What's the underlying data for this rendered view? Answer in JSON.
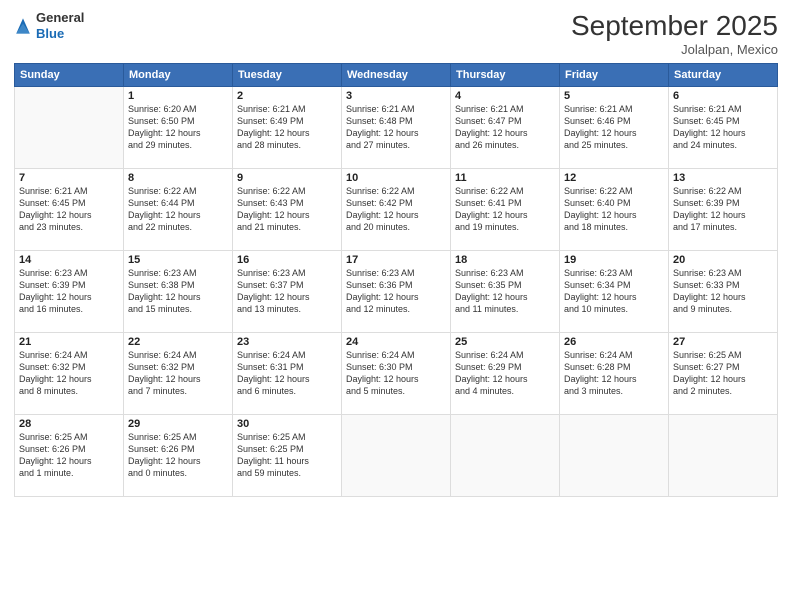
{
  "logo": {
    "line1": "General",
    "line2": "Blue"
  },
  "title": {
    "month_year": "September 2025",
    "location": "Jolalpan, Mexico"
  },
  "weekdays": [
    "Sunday",
    "Monday",
    "Tuesday",
    "Wednesday",
    "Thursday",
    "Friday",
    "Saturday"
  ],
  "weeks": [
    [
      {
        "day": "",
        "info": ""
      },
      {
        "day": "1",
        "info": "Sunrise: 6:20 AM\nSunset: 6:50 PM\nDaylight: 12 hours\nand 29 minutes."
      },
      {
        "day": "2",
        "info": "Sunrise: 6:21 AM\nSunset: 6:49 PM\nDaylight: 12 hours\nand 28 minutes."
      },
      {
        "day": "3",
        "info": "Sunrise: 6:21 AM\nSunset: 6:48 PM\nDaylight: 12 hours\nand 27 minutes."
      },
      {
        "day": "4",
        "info": "Sunrise: 6:21 AM\nSunset: 6:47 PM\nDaylight: 12 hours\nand 26 minutes."
      },
      {
        "day": "5",
        "info": "Sunrise: 6:21 AM\nSunset: 6:46 PM\nDaylight: 12 hours\nand 25 minutes."
      },
      {
        "day": "6",
        "info": "Sunrise: 6:21 AM\nSunset: 6:45 PM\nDaylight: 12 hours\nand 24 minutes."
      }
    ],
    [
      {
        "day": "7",
        "info": "Sunrise: 6:21 AM\nSunset: 6:45 PM\nDaylight: 12 hours\nand 23 minutes."
      },
      {
        "day": "8",
        "info": "Sunrise: 6:22 AM\nSunset: 6:44 PM\nDaylight: 12 hours\nand 22 minutes."
      },
      {
        "day": "9",
        "info": "Sunrise: 6:22 AM\nSunset: 6:43 PM\nDaylight: 12 hours\nand 21 minutes."
      },
      {
        "day": "10",
        "info": "Sunrise: 6:22 AM\nSunset: 6:42 PM\nDaylight: 12 hours\nand 20 minutes."
      },
      {
        "day": "11",
        "info": "Sunrise: 6:22 AM\nSunset: 6:41 PM\nDaylight: 12 hours\nand 19 minutes."
      },
      {
        "day": "12",
        "info": "Sunrise: 6:22 AM\nSunset: 6:40 PM\nDaylight: 12 hours\nand 18 minutes."
      },
      {
        "day": "13",
        "info": "Sunrise: 6:22 AM\nSunset: 6:39 PM\nDaylight: 12 hours\nand 17 minutes."
      }
    ],
    [
      {
        "day": "14",
        "info": "Sunrise: 6:23 AM\nSunset: 6:39 PM\nDaylight: 12 hours\nand 16 minutes."
      },
      {
        "day": "15",
        "info": "Sunrise: 6:23 AM\nSunset: 6:38 PM\nDaylight: 12 hours\nand 15 minutes."
      },
      {
        "day": "16",
        "info": "Sunrise: 6:23 AM\nSunset: 6:37 PM\nDaylight: 12 hours\nand 13 minutes."
      },
      {
        "day": "17",
        "info": "Sunrise: 6:23 AM\nSunset: 6:36 PM\nDaylight: 12 hours\nand 12 minutes."
      },
      {
        "day": "18",
        "info": "Sunrise: 6:23 AM\nSunset: 6:35 PM\nDaylight: 12 hours\nand 11 minutes."
      },
      {
        "day": "19",
        "info": "Sunrise: 6:23 AM\nSunset: 6:34 PM\nDaylight: 12 hours\nand 10 minutes."
      },
      {
        "day": "20",
        "info": "Sunrise: 6:23 AM\nSunset: 6:33 PM\nDaylight: 12 hours\nand 9 minutes."
      }
    ],
    [
      {
        "day": "21",
        "info": "Sunrise: 6:24 AM\nSunset: 6:32 PM\nDaylight: 12 hours\nand 8 minutes."
      },
      {
        "day": "22",
        "info": "Sunrise: 6:24 AM\nSunset: 6:32 PM\nDaylight: 12 hours\nand 7 minutes."
      },
      {
        "day": "23",
        "info": "Sunrise: 6:24 AM\nSunset: 6:31 PM\nDaylight: 12 hours\nand 6 minutes."
      },
      {
        "day": "24",
        "info": "Sunrise: 6:24 AM\nSunset: 6:30 PM\nDaylight: 12 hours\nand 5 minutes."
      },
      {
        "day": "25",
        "info": "Sunrise: 6:24 AM\nSunset: 6:29 PM\nDaylight: 12 hours\nand 4 minutes."
      },
      {
        "day": "26",
        "info": "Sunrise: 6:24 AM\nSunset: 6:28 PM\nDaylight: 12 hours\nand 3 minutes."
      },
      {
        "day": "27",
        "info": "Sunrise: 6:25 AM\nSunset: 6:27 PM\nDaylight: 12 hours\nand 2 minutes."
      }
    ],
    [
      {
        "day": "28",
        "info": "Sunrise: 6:25 AM\nSunset: 6:26 PM\nDaylight: 12 hours\nand 1 minute."
      },
      {
        "day": "29",
        "info": "Sunrise: 6:25 AM\nSunset: 6:26 PM\nDaylight: 12 hours\nand 0 minutes."
      },
      {
        "day": "30",
        "info": "Sunrise: 6:25 AM\nSunset: 6:25 PM\nDaylight: 11 hours\nand 59 minutes."
      },
      {
        "day": "",
        "info": ""
      },
      {
        "day": "",
        "info": ""
      },
      {
        "day": "",
        "info": ""
      },
      {
        "day": "",
        "info": ""
      }
    ]
  ]
}
